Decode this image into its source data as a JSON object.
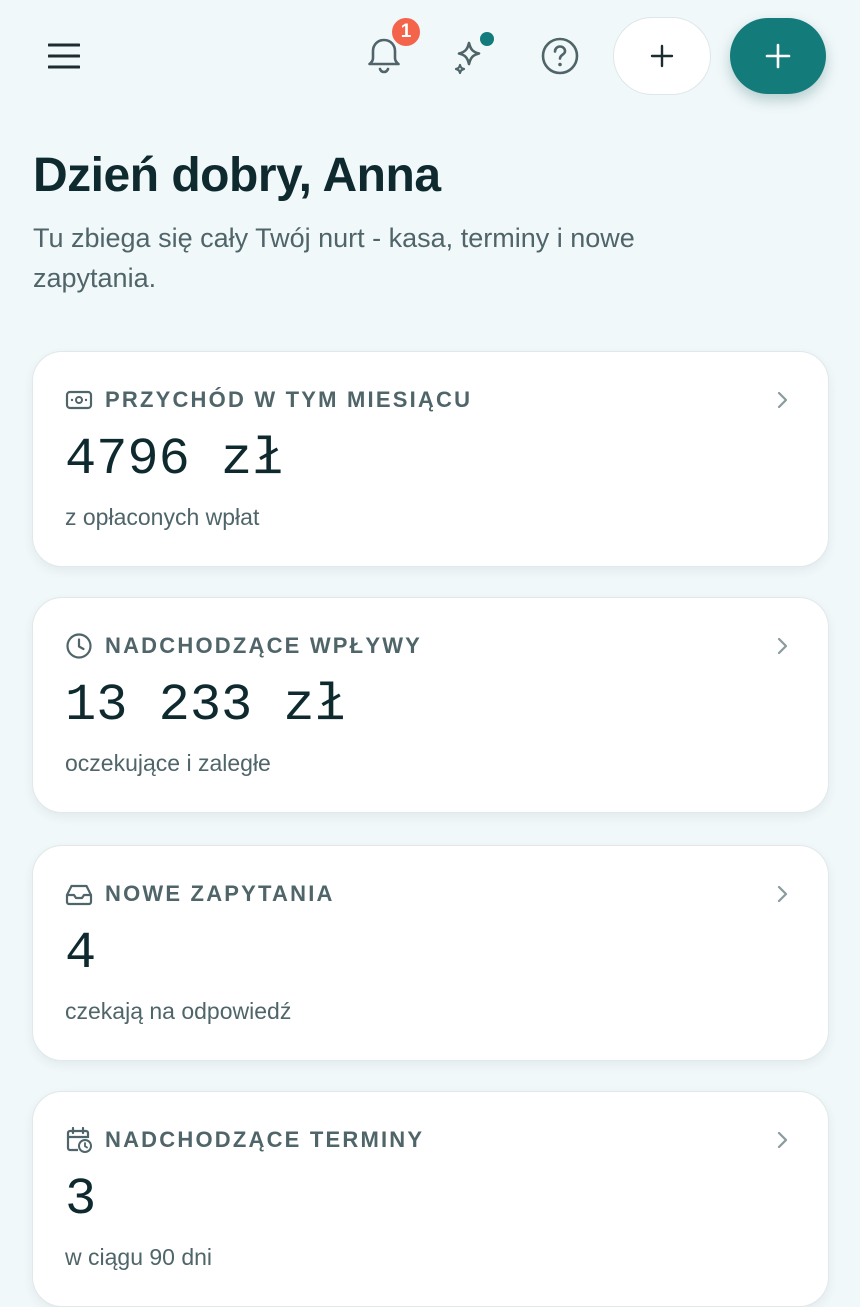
{
  "header": {
    "notification_count": "1"
  },
  "greeting": "Dzień dobry, Anna",
  "subtitle": "Tu zbiega się cały Twój nurt - kasa, terminy i nowe zapytania.",
  "cards": [
    {
      "icon": "cash-icon",
      "label": "PRZYCHÓD W TYM MIESIĄCU",
      "value": "4796 zł",
      "desc": "z opłaconych wpłat"
    },
    {
      "icon": "clock-icon",
      "label": "NADCHODZĄCE WPŁYWY",
      "value": "13 233 zł",
      "desc": "oczekujące i zaległe"
    },
    {
      "icon": "inbox-icon",
      "label": "NOWE ZAPYTANIA",
      "value": "4",
      "desc": "czekają na odpowiedź"
    },
    {
      "icon": "calendar-clock-icon",
      "label": "NADCHODZĄCE TERMINY",
      "value": "3",
      "desc": "w ciągu 90 dni"
    }
  ],
  "colors": {
    "accent": "#147b7b",
    "badge": "#f4644a",
    "background": "#f1f8fa",
    "text_primary": "#0f2a2e",
    "text_secondary": "#4f6569"
  }
}
